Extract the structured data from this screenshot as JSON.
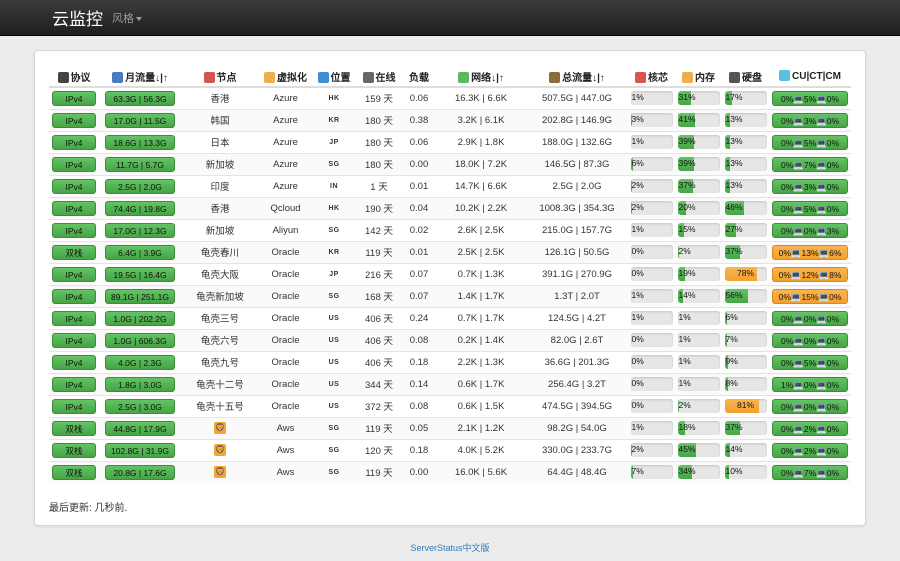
{
  "nav": {
    "brand": "云监控",
    "styles_label": "风格"
  },
  "columns": [
    {
      "label": "协议",
      "icon": "shield-icon",
      "color": "#444"
    },
    {
      "label": "月流量↓|↑",
      "icon": "bar-chart-icon",
      "color": "#4a7abf"
    },
    {
      "label": "节点",
      "icon": "pin-icon",
      "color": "#d9534f"
    },
    {
      "label": "虚拟化",
      "icon": "folder-icon",
      "color": "#f0ad4e"
    },
    {
      "label": "位置",
      "icon": "globe-icon",
      "color": "#3a8fd6"
    },
    {
      "label": "在线",
      "icon": "clock-icon",
      "color": "#666"
    },
    {
      "label": "负载",
      "icon": "",
      "color": ""
    },
    {
      "label": "网络↓|↑",
      "icon": "traffic-light-icon",
      "color": "#5cb85c"
    },
    {
      "label": "总流量↓|↑",
      "icon": "clipboard-icon",
      "color": "#8a6d3b"
    },
    {
      "label": "核芯",
      "icon": "target-icon",
      "color": "#d9534f"
    },
    {
      "label": "内存",
      "icon": "lightning-icon",
      "color": "#f0ad4e"
    },
    {
      "label": "硬盘",
      "icon": "disk-icon",
      "color": "#555"
    },
    {
      "label": "CU|CT|CM",
      "icon": "network-icon",
      "color": "#5bc0de"
    }
  ],
  "servers": [
    {
      "protocol": "IPv4",
      "monthly": "63.3G | 56.3G",
      "node": "香港",
      "virt": "Azure",
      "loc": "HK",
      "uptime": "159 天",
      "load": "0.06",
      "network": "16.3K | 6.6K",
      "total": "507.5G | 447.0G",
      "cpu": 1,
      "mem": 31,
      "disk": 17,
      "isp": "0%💻5%💻0%",
      "isp_warn": false
    },
    {
      "protocol": "IPv4",
      "monthly": "17.0G | 11.5G",
      "node": "韩国",
      "virt": "Azure",
      "loc": "KR",
      "uptime": "180 天",
      "load": "0.38",
      "network": "3.2K | 6.1K",
      "total": "202.8G | 146.9G",
      "cpu": 3,
      "mem": 41,
      "disk": 13,
      "isp": "0%💻3%💻0%",
      "isp_warn": false
    },
    {
      "protocol": "IPv4",
      "monthly": "18.6G | 13.3G",
      "node": "日本",
      "virt": "Azure",
      "loc": "JP",
      "uptime": "180 天",
      "load": "0.06",
      "network": "2.9K | 1.8K",
      "total": "188.0G | 132.6G",
      "cpu": 1,
      "mem": 39,
      "disk": 13,
      "isp": "0%💻5%💻0%",
      "isp_warn": false
    },
    {
      "protocol": "IPv4",
      "monthly": "11.7G | 5.7G",
      "node": "新加坡",
      "virt": "Azure",
      "loc": "SG",
      "uptime": "180 天",
      "load": "0.00",
      "network": "18.0K | 7.2K",
      "total": "146.5G | 87.3G",
      "cpu": 6,
      "mem": 39,
      "disk": 13,
      "isp": "0%💻7%💻0%",
      "isp_warn": false
    },
    {
      "protocol": "IPv4",
      "monthly": "2.5G | 2.0G",
      "node": "印度",
      "virt": "Azure",
      "loc": "IN",
      "uptime": "1 天",
      "load": "0.01",
      "network": "14.7K | 6.6K",
      "total": "2.5G | 2.0G",
      "cpu": 2,
      "mem": 37,
      "disk": 13,
      "isp": "0%💻3%💻0%",
      "isp_warn": false
    },
    {
      "protocol": "IPv4",
      "monthly": "74.4G | 19.8G",
      "node": "香港",
      "virt": "Qcloud",
      "loc": "HK",
      "uptime": "190 天",
      "load": "0.04",
      "network": "10.2K | 2.2K",
      "total": "1008.3G | 354.3G",
      "cpu": 2,
      "mem": 20,
      "disk": 46,
      "isp": "0%💻5%💻0%",
      "isp_warn": false
    },
    {
      "protocol": "IPv4",
      "monthly": "17.0G | 12.3G",
      "node": "新加坡",
      "virt": "Aliyun",
      "loc": "SG",
      "uptime": "142 天",
      "load": "0.02",
      "network": "2.6K | 2.5K",
      "total": "215.0G | 157.7G",
      "cpu": 1,
      "mem": 15,
      "disk": 27,
      "isp": "0%💻0%💻3%",
      "isp_warn": false
    },
    {
      "protocol": "双栈",
      "monthly": "6.4G | 3.9G",
      "node": "龟壳春川",
      "virt": "Oracle",
      "loc": "KR",
      "uptime": "119 天",
      "load": "0.01",
      "network": "2.5K | 2.5K",
      "total": "126.1G | 50.5G",
      "cpu": 0,
      "mem": 2,
      "disk": 37,
      "isp": "0%💻13%💻6%",
      "isp_warn": true
    },
    {
      "protocol": "IPv4",
      "monthly": "19.5G | 16.4G",
      "node": "龟壳大阪",
      "virt": "Oracle",
      "loc": "JP",
      "uptime": "216 天",
      "load": "0.07",
      "network": "0.7K | 1.3K",
      "total": "391.1G | 270.9G",
      "cpu": 0,
      "mem": 19,
      "disk": 78,
      "isp": "0%💻12%💻8%",
      "isp_warn": true
    },
    {
      "protocol": "IPv4",
      "monthly": "89.1G | 251.1G",
      "node": "龟壳新加坡",
      "virt": "Oracle",
      "loc": "SG",
      "uptime": "168 天",
      "load": "0.07",
      "network": "1.4K | 1.7K",
      "total": "1.3T | 2.0T",
      "cpu": 1,
      "mem": 14,
      "disk": 56,
      "isp": "0%💻15%💻0%",
      "isp_warn": true
    },
    {
      "protocol": "IPv4",
      "monthly": "1.0G | 202.2G",
      "node": "龟壳三号",
      "virt": "Oracle",
      "loc": "US",
      "uptime": "406 天",
      "load": "0.24",
      "network": "0.7K | 1.7K",
      "total": "124.5G | 4.2T",
      "cpu": 1,
      "mem": 1,
      "disk": 6,
      "isp": "0%💻0%💻0%",
      "isp_warn": false
    },
    {
      "protocol": "IPv4",
      "monthly": "1.0G | 606.3G",
      "node": "龟壳六号",
      "virt": "Oracle",
      "loc": "US",
      "uptime": "406 天",
      "load": "0.08",
      "network": "0.2K | 1.4K",
      "total": "82.0G | 2.6T",
      "cpu": 0,
      "mem": 1,
      "disk": 7,
      "isp": "0%💻0%💻0%",
      "isp_warn": false
    },
    {
      "protocol": "IPv4",
      "monthly": "4.0G | 2.3G",
      "node": "龟壳九号",
      "virt": "Oracle",
      "loc": "US",
      "uptime": "406 天",
      "load": "0.18",
      "network": "2.2K | 1.3K",
      "total": "36.6G | 201.3G",
      "cpu": 0,
      "mem": 1,
      "disk": 9,
      "isp": "0%💻5%💻0%",
      "isp_warn": false
    },
    {
      "protocol": "IPv4",
      "monthly": "1.8G | 3.0G",
      "node": "龟壳十二号",
      "virt": "Oracle",
      "loc": "US",
      "uptime": "344 天",
      "load": "0.14",
      "network": "0.6K | 1.7K",
      "total": "256.4G | 3.2T",
      "cpu": 0,
      "mem": 1,
      "disk": 8,
      "isp": "1%💻0%💻0%",
      "isp_warn": false
    },
    {
      "protocol": "IPv4",
      "monthly": "2.5G | 3.0G",
      "node": "龟壳十五号",
      "virt": "Oracle",
      "loc": "US",
      "uptime": "372 天",
      "load": "0.08",
      "network": "0.6K | 1.5K",
      "total": "474.5G | 394.5G",
      "cpu": 0,
      "mem": 2,
      "disk": 81,
      "disk_warn": true,
      "isp": "0%💻0%💻0%",
      "isp_warn": false
    },
    {
      "protocol": "双栈",
      "monthly": "44.8G | 17.9G",
      "node": "",
      "node_icon": "lion-icon",
      "virt": "Aws",
      "loc": "SG",
      "uptime": "119 天",
      "load": "0.05",
      "network": "2.1K | 1.2K",
      "total": "98.2G | 54.0G",
      "cpu": 1,
      "mem": 18,
      "disk": 37,
      "isp": "0%💻2%💻0%",
      "isp_warn": false
    },
    {
      "protocol": "双栈",
      "monthly": "102.8G | 31.9G",
      "node": "",
      "node_icon": "lion-icon",
      "virt": "Aws",
      "loc": "SG",
      "uptime": "120 天",
      "load": "0.18",
      "network": "4.0K | 5.2K",
      "total": "330.0G | 233.7G",
      "cpu": 2,
      "mem": 45,
      "disk": 14,
      "isp": "0%💻2%💻0%",
      "isp_warn": false
    },
    {
      "protocol": "双栈",
      "monthly": "20.8G | 17.6G",
      "node": "",
      "node_icon": "lion-icon",
      "virt": "Aws",
      "loc": "SG",
      "uptime": "119 天",
      "load": "0.00",
      "network": "16.0K | 5.6K",
      "total": "64.4G | 48.4G",
      "cpu": 7,
      "mem": 34,
      "disk": 10,
      "isp": "0%💻7%💻0%",
      "isp_warn": false
    }
  ],
  "footer": {
    "updated": "最后更新: 几秒前.",
    "link": "ServerStatus中文版"
  },
  "colors": {
    "green": "#5cb85c",
    "orange": "#f0ad4e",
    "link": "#337ab7"
  }
}
